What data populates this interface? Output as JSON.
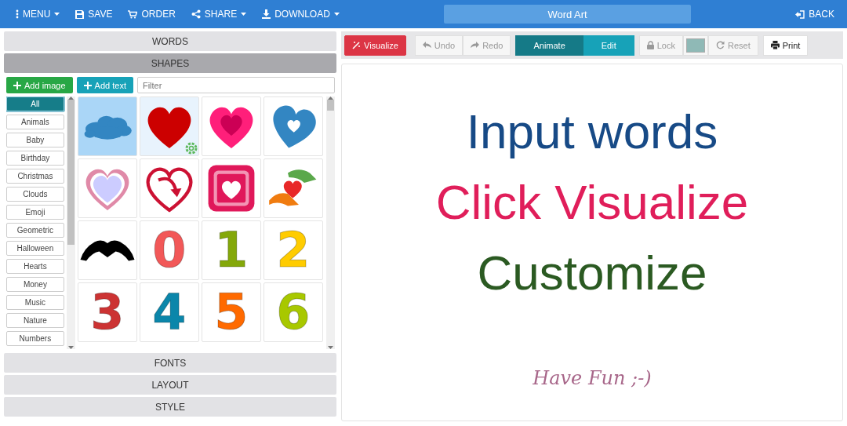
{
  "topbar": {
    "items": [
      {
        "label": "MENU",
        "caret": true
      },
      {
        "label": "SAVE",
        "caret": false
      },
      {
        "label": "ORDER",
        "caret": false
      },
      {
        "label": "SHARE",
        "caret": true
      },
      {
        "label": "DOWNLOAD",
        "caret": true
      }
    ],
    "title": "Word Art",
    "back": "BACK"
  },
  "panels": [
    {
      "label": "WORDS",
      "expanded": false
    },
    {
      "label": "SHAPES",
      "expanded": true,
      "content": {
        "add_image": "Add image",
        "add_text": "Add text",
        "filter": {
          "placeholder": "Filter"
        },
        "categories": [
          {
            "label": "All",
            "selected": true
          },
          {
            "label": "Animals",
            "selected": false
          },
          {
            "label": "Baby",
            "selected": false
          },
          {
            "label": "Birthday",
            "selected": false
          },
          {
            "label": "Christmas",
            "selected": false
          },
          {
            "label": "Clouds",
            "selected": false
          },
          {
            "label": "Emoji",
            "selected": false
          },
          {
            "label": "Geometric",
            "selected": false
          },
          {
            "label": "Halloween",
            "selected": false
          },
          {
            "label": "Hearts",
            "selected": false
          },
          {
            "label": "Money",
            "selected": false
          },
          {
            "label": "Music",
            "selected": false
          },
          {
            "label": "Nature",
            "selected": false
          },
          {
            "label": "Numbers",
            "selected": false
          }
        ],
        "shapes": [
          {
            "kind": "cloud",
            "color": "#3386c2",
            "selected": true,
            "hovered": false
          },
          {
            "kind": "heart",
            "color": "#cc0000",
            "selected": false,
            "hovered": true
          },
          {
            "kind": "double-heart",
            "color": "#ff1f7a",
            "selected": false,
            "hovered": false
          },
          {
            "kind": "ringed-heart",
            "color": "#3386c2",
            "selected": false,
            "hovered": false
          },
          {
            "kind": "hollow-heart",
            "color": "#e08aa8",
            "selected": false,
            "hovered": false
          },
          {
            "kind": "arrow-heart",
            "color": "#cc1133",
            "selected": false,
            "hovered": false
          },
          {
            "kind": "framed-heart",
            "color": "#e0185a",
            "selected": false,
            "hovered": false
          },
          {
            "kind": "hands-heart",
            "color": "#e82828",
            "selected": false,
            "hovered": false
          },
          {
            "kind": "hand-heart",
            "color": "#000000",
            "selected": false,
            "hovered": false
          },
          {
            "kind": "digit",
            "label": "0",
            "color": "#f25858",
            "selected": false,
            "hovered": false
          },
          {
            "kind": "digit",
            "label": "1",
            "color": "#84a80a",
            "selected": false,
            "hovered": false
          },
          {
            "kind": "digit",
            "label": "2",
            "color": "#ffcc00",
            "selected": false,
            "hovered": false
          },
          {
            "kind": "digit",
            "label": "3",
            "color": "#cc3333",
            "selected": false,
            "hovered": false
          },
          {
            "kind": "digit",
            "label": "4",
            "color": "#0b86aa",
            "selected": false,
            "hovered": false
          },
          {
            "kind": "digit",
            "label": "5",
            "color": "#ff6a00",
            "selected": false,
            "hovered": false
          },
          {
            "kind": "digit",
            "label": "6",
            "color": "#a8c800",
            "selected": false,
            "hovered": false
          }
        ]
      }
    },
    {
      "label": "FONTS",
      "expanded": false
    },
    {
      "label": "LAYOUT",
      "expanded": false
    },
    {
      "label": "STYLE",
      "expanded": false
    }
  ],
  "actions": [
    {
      "kind": "visualize",
      "label": "Visualize"
    },
    {
      "kind": "undo",
      "label": "Undo",
      "disabled": true
    },
    {
      "kind": "redo",
      "label": "Redo",
      "disabled": true
    },
    {
      "kind": "mode",
      "label": "Animate",
      "selected": true
    },
    {
      "kind": "mode",
      "label": "Edit",
      "selected": false
    },
    {
      "kind": "lock",
      "label": "Lock",
      "disabled": true
    },
    {
      "kind": "swatch",
      "color": "#8fb9b6"
    },
    {
      "kind": "reset",
      "label": "Reset",
      "disabled": true
    },
    {
      "kind": "print",
      "label": "Print"
    }
  ],
  "canvas": {
    "lines": [
      {
        "text": "Input words",
        "kind": "headline",
        "color": "#174a86"
      },
      {
        "text": "Click Visualize",
        "kind": "headline",
        "color": "#e01e5a"
      },
      {
        "text": "Customize",
        "kind": "headline",
        "color": "#2b5a22"
      },
      {
        "text": "Have Fun ;-)",
        "kind": "note",
        "color": "#a8678a"
      }
    ]
  }
}
